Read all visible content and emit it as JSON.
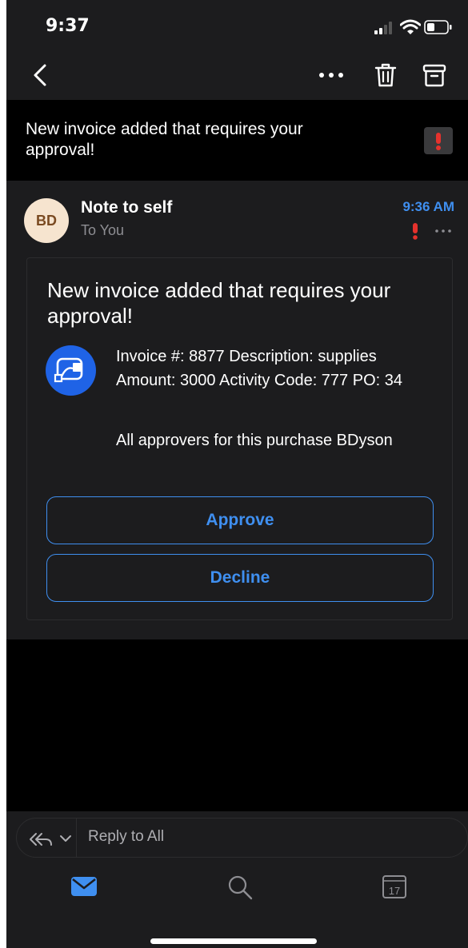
{
  "status_bar": {
    "time": "9:37"
  },
  "toolbar": {
    "back_icon": "chevron-left-icon",
    "more_icon": "more-horizontal-icon",
    "delete_icon": "trash-icon",
    "archive_icon": "archive-icon"
  },
  "subject": "New invoice added that requires your approval!",
  "message": {
    "avatar_initials": "BD",
    "sender": "Note to self",
    "recipient": "To You",
    "time": "9:36 AM",
    "card": {
      "title": "New invoice added that requires your approval!",
      "details": "Invoice #: 8877 Description: supplies Amount: 3000 Activity Code: 777 PO: 34",
      "approvers": "All approvers for this purchase BDyson",
      "approve_label": "Approve",
      "decline_label": "Decline"
    }
  },
  "reply": {
    "placeholder": "Reply to All"
  },
  "tabs": {
    "calendar_day": "17"
  },
  "colors": {
    "accent": "#3f8ff0",
    "background": "#000000",
    "surface": "#1c1c1e",
    "flag_red": "#e5322d",
    "app_icon_blue": "#1f63e6",
    "avatar_bg": "#f6e4cf"
  }
}
